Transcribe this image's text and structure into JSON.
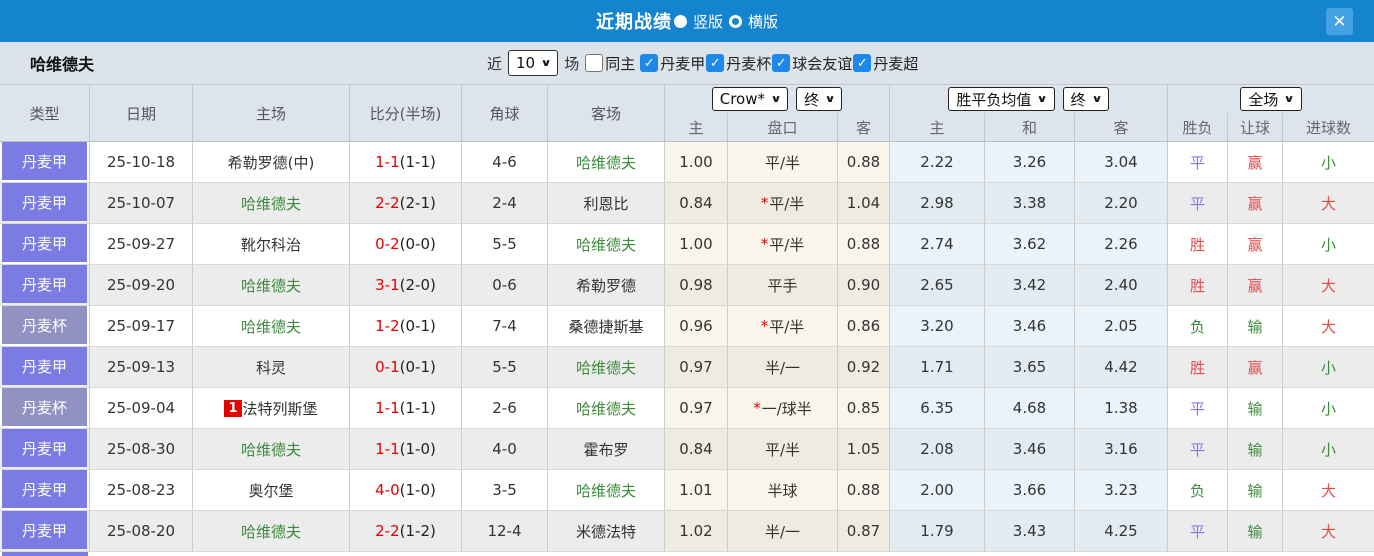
{
  "colors": {
    "accent": "#1484cf",
    "league_jia": "#7b7be4",
    "league_bei": "#9191c2",
    "red": "#e34b4b",
    "blue": "#7a7af0",
    "green": "#3d8b3d",
    "score_red": "#e60000"
  },
  "titlebar": {
    "title": "近期战绩",
    "radio_vertical": "竖版",
    "radio_horizontal": "横版",
    "close_label": "✕"
  },
  "filters": {
    "team": "哈维德夫",
    "recent_label": "近",
    "recent_value": "10",
    "matches_label": "场",
    "checkboxes": [
      {
        "label": "同主",
        "checked": false
      },
      {
        "label": "丹麦甲",
        "checked": true
      },
      {
        "label": "丹麦杯",
        "checked": true
      },
      {
        "label": "球会友谊",
        "checked": true
      },
      {
        "label": "丹麦超",
        "checked": true
      }
    ]
  },
  "table": {
    "main_headers": [
      "类型",
      "日期",
      "主场",
      "比分(半场)",
      "角球",
      "客场"
    ],
    "dropdowns": {
      "odds_company": "Crow*",
      "odds_time_1": "终",
      "avg_label": "胜平负均值",
      "odds_time_2": "终",
      "scope": "全场"
    },
    "sub_headers": [
      "主",
      "盘口",
      "客",
      "主",
      "和",
      "客",
      "胜负",
      "让球",
      "进球数"
    ],
    "rows": [
      {
        "league": "丹麦甲",
        "date": "25-10-18",
        "home": "希勒罗德(中)",
        "home_focus": false,
        "home_badge": "",
        "score": "1-1",
        "half": "1-1",
        "corner": "4-6",
        "away": "哈维德夫",
        "away_focus": true,
        "let_home": "1.00",
        "handicap": "平/半",
        "let_away": "0.88",
        "avg_home": "2.22",
        "avg_draw": "3.26",
        "avg_away": "3.04",
        "outcome": "平",
        "outcome_color": "blue",
        "let_result": "赢",
        "let_result_color": "red",
        "goals": "小",
        "goals_color": "green"
      },
      {
        "league": "丹麦甲",
        "date": "25-10-07",
        "home": "哈维德夫",
        "home_focus": true,
        "home_badge": "",
        "score": "2-2",
        "half": "2-1",
        "corner": "2-4",
        "away": "利恩比",
        "away_focus": false,
        "let_home": "0.84",
        "handicap": "*平/半",
        "let_away": "1.04",
        "avg_home": "2.98",
        "avg_draw": "3.38",
        "avg_away": "2.20",
        "outcome": "平",
        "outcome_color": "blue",
        "let_result": "赢",
        "let_result_color": "red",
        "goals": "大",
        "goals_color": "red"
      },
      {
        "league": "丹麦甲",
        "date": "25-09-27",
        "home": "靴尔科治",
        "home_focus": false,
        "home_badge": "",
        "score": "0-2",
        "half": "0-0",
        "corner": "5-5",
        "away": "哈维德夫",
        "away_focus": true,
        "let_home": "1.00",
        "handicap": "*平/半",
        "let_away": "0.88",
        "avg_home": "2.74",
        "avg_draw": "3.62",
        "avg_away": "2.26",
        "outcome": "胜",
        "outcome_color": "red",
        "let_result": "赢",
        "let_result_color": "red",
        "goals": "小",
        "goals_color": "green"
      },
      {
        "league": "丹麦甲",
        "date": "25-09-20",
        "home": "哈维德夫",
        "home_focus": true,
        "home_badge": "",
        "score": "3-1",
        "half": "2-0",
        "corner": "0-6",
        "away": "希勒罗德",
        "away_focus": false,
        "let_home": "0.98",
        "handicap": "平手",
        "let_away": "0.90",
        "avg_home": "2.65",
        "avg_draw": "3.42",
        "avg_away": "2.40",
        "outcome": "胜",
        "outcome_color": "red",
        "let_result": "赢",
        "let_result_color": "red",
        "goals": "大",
        "goals_color": "red"
      },
      {
        "league": "丹麦杯",
        "date": "25-09-17",
        "home": "哈维德夫",
        "home_focus": true,
        "home_badge": "",
        "score": "1-2",
        "half": "0-1",
        "corner": "7-4",
        "away": "桑德捷斯基",
        "away_focus": false,
        "let_home": "0.96",
        "handicap": "*平/半",
        "let_away": "0.86",
        "avg_home": "3.20",
        "avg_draw": "3.46",
        "avg_away": "2.05",
        "outcome": "负",
        "outcome_color": "green",
        "let_result": "输",
        "let_result_color": "green",
        "goals": "大",
        "goals_color": "red"
      },
      {
        "league": "丹麦甲",
        "date": "25-09-13",
        "home": "科灵",
        "home_focus": false,
        "home_badge": "",
        "score": "0-1",
        "half": "0-1",
        "corner": "5-5",
        "away": "哈维德夫",
        "away_focus": true,
        "let_home": "0.97",
        "handicap": "半/一",
        "let_away": "0.92",
        "avg_home": "1.71",
        "avg_draw": "3.65",
        "avg_away": "4.42",
        "outcome": "胜",
        "outcome_color": "red",
        "let_result": "赢",
        "let_result_color": "red",
        "goals": "小",
        "goals_color": "green"
      },
      {
        "league": "丹麦杯",
        "date": "25-09-04",
        "home": "法特列斯堡",
        "home_focus": false,
        "home_badge": "1",
        "score": "1-1",
        "half": "1-1",
        "corner": "2-6",
        "away": "哈维德夫",
        "away_focus": true,
        "let_home": "0.97",
        "handicap": "*一/球半",
        "let_away": "0.85",
        "avg_home": "6.35",
        "avg_draw": "4.68",
        "avg_away": "1.38",
        "outcome": "平",
        "outcome_color": "blue",
        "let_result": "输",
        "let_result_color": "green",
        "goals": "小",
        "goals_color": "green"
      },
      {
        "league": "丹麦甲",
        "date": "25-08-30",
        "home": "哈维德夫",
        "home_focus": true,
        "home_badge": "",
        "score": "1-1",
        "half": "1-0",
        "corner": "4-0",
        "away": "霍布罗",
        "away_focus": false,
        "let_home": "0.84",
        "handicap": "平/半",
        "let_away": "1.05",
        "avg_home": "2.08",
        "avg_draw": "3.46",
        "avg_away": "3.16",
        "outcome": "平",
        "outcome_color": "blue",
        "let_result": "输",
        "let_result_color": "green",
        "goals": "小",
        "goals_color": "green"
      },
      {
        "league": "丹麦甲",
        "date": "25-08-23",
        "home": "奥尔堡",
        "home_focus": false,
        "home_badge": "",
        "score": "4-0",
        "half": "1-0",
        "corner": "3-5",
        "away": "哈维德夫",
        "away_focus": true,
        "let_home": "1.01",
        "handicap": "半球",
        "let_away": "0.88",
        "avg_home": "2.00",
        "avg_draw": "3.66",
        "avg_away": "3.23",
        "outcome": "负",
        "outcome_color": "green",
        "let_result": "输",
        "let_result_color": "green",
        "goals": "大",
        "goals_color": "red"
      },
      {
        "league": "丹麦甲",
        "date": "25-08-20",
        "home": "哈维德夫",
        "home_focus": true,
        "home_badge": "",
        "score": "2-2",
        "half": "1-2",
        "corner": "12-4",
        "away": "米德法特",
        "away_focus": false,
        "let_home": "1.02",
        "handicap": "半/一",
        "let_away": "0.87",
        "avg_home": "1.79",
        "avg_draw": "3.43",
        "avg_away": "4.25",
        "outcome": "平",
        "outcome_color": "blue",
        "let_result": "输",
        "let_result_color": "green",
        "goals": "大",
        "goals_color": "red"
      }
    ]
  }
}
